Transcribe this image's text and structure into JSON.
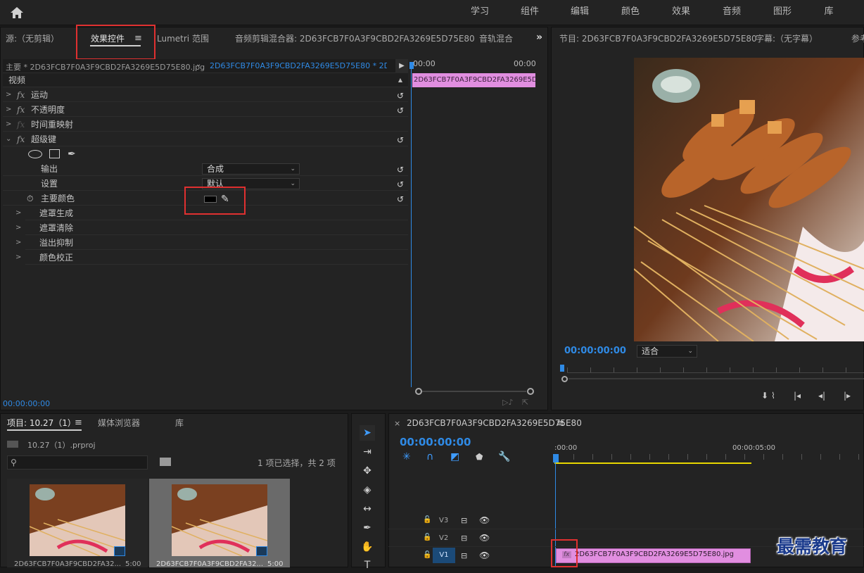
{
  "workspaces": [
    "学习",
    "组件",
    "编辑",
    "颜色",
    "效果",
    "音频",
    "图形",
    "库"
  ],
  "source_panel": {
    "tabs": [
      "源:（无剪辑）",
      "效果控件",
      "Lumetri 范围",
      "音频剪辑混合器: 2D63FCB7F0A3F9CBD2FA3269E5D75E80",
      "音轨混合"
    ],
    "menu_icon": "≡",
    "more": "»",
    "master_label": "主要 * 2D63FCB7F0A3F9CBD2FA3269E5D75E80.jpg",
    "clip_label": "2D63FCB7F0A3F9CBD2FA3269E5D75E80 * 2D63...",
    "time_start": "00:00",
    "time_end": "00:00",
    "clip_bar": "2D63FCB7F0A3F9CBD2FA3269E5D",
    "section": "视频",
    "effects": [
      "运动",
      "不透明度",
      "时间重映射",
      "超级键"
    ],
    "output_label": "输出",
    "output_value": "合成",
    "settings_label": "设置",
    "settings_value": "默认",
    "key_color_label": "主要颜色",
    "key_color": "#000000",
    "subgroups": [
      "遮罩生成",
      "遮罩清除",
      "溢出抑制",
      "颜色校正"
    ],
    "timecode": "00:00:00:00"
  },
  "program_panel": {
    "tabs": [
      "节目: 2D63FCB7F0A3F9CBD2FA3269E5D75E80",
      "字幕:（无字幕）",
      "参考"
    ],
    "timecode": "00:00:00:00",
    "fit_value": "适合"
  },
  "project_panel": {
    "tabs": [
      "项目: 10.27（1）",
      "媒体浏览器",
      "库"
    ],
    "file": "10.27（1）.prproj",
    "selection": "1 项已选择，共 2 项",
    "thumb_caption": "2D63FCB7F0A3F9CBD2FA32...",
    "thumb_dur": "5:00"
  },
  "timeline": {
    "seq_name": "2D63FCB7F0A3F9CBD2FA3269E5D75E80",
    "timecode": "00:00:00:00",
    "ruler_start": ":00:00",
    "ruler_mid": "00:00:05:00",
    "tracks": [
      "V3",
      "V2",
      "V1"
    ],
    "clip_name": "2D63FCB7F0A3F9CBD2FA3269E5D75E80.jpg"
  },
  "watermark": "最需教育",
  "colors": {
    "accent": "#2f8ae5",
    "clip": "#e18ee0",
    "highlight": "#e03030",
    "work_area": "#e8d700"
  }
}
